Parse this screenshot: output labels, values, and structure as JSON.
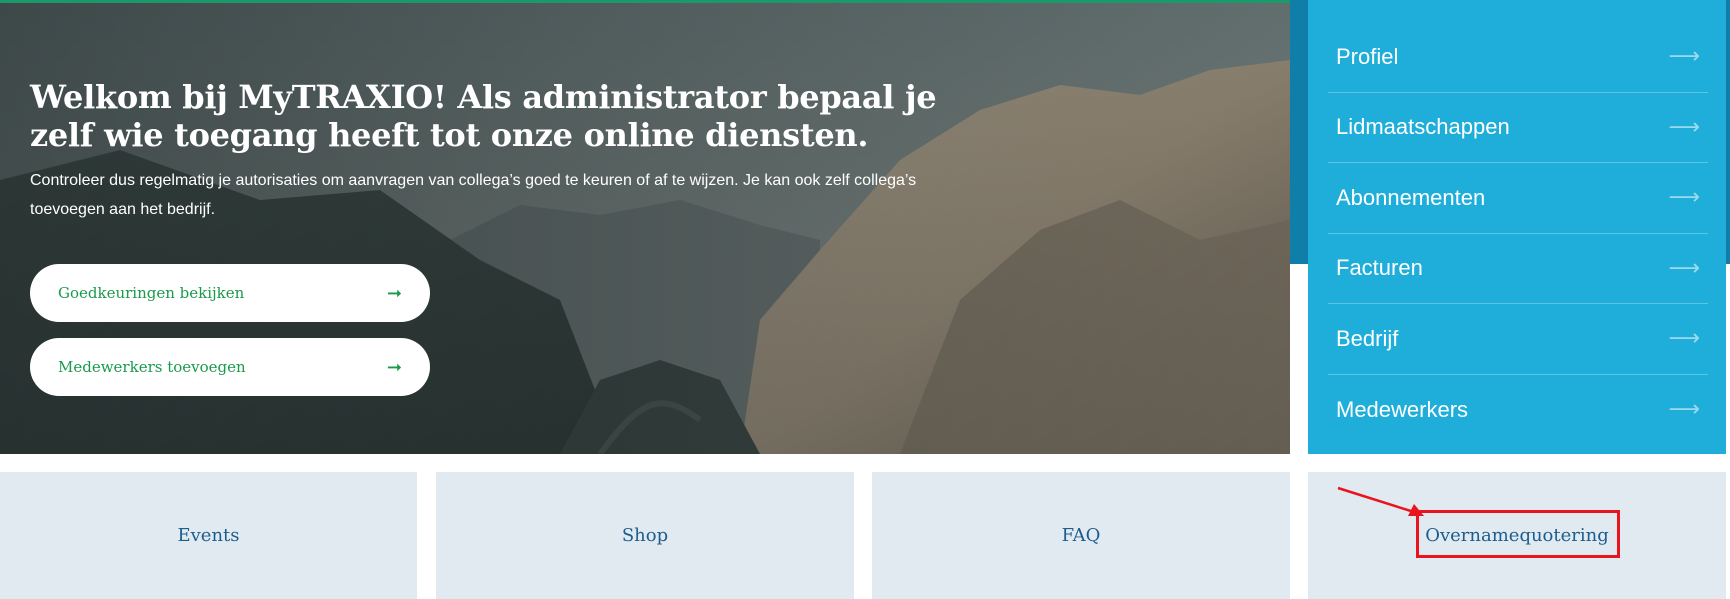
{
  "hero": {
    "title": "Welkom bij MyTRAXIO! Als administrator bepaal je zelf wie toegang heeft tot onze online diensten.",
    "text": "Controleer dus regelmatig je autorisaties om aanvragen van collega’s goed te keuren of af te wijzen. Je kan ook zelf collega’s toevoegen aan het bedrijf.",
    "buttons": [
      {
        "label": "Goedkeuringen bekijken",
        "icon": "arrow-right-icon"
      },
      {
        "label": "Medewerkers toevoegen",
        "icon": "arrow-right-icon"
      }
    ]
  },
  "side_menu": {
    "items": [
      {
        "label": "Profiel"
      },
      {
        "label": "Lidmaatschappen"
      },
      {
        "label": "Abonnementen"
      },
      {
        "label": "Facturen"
      },
      {
        "label": "Bedrijf"
      },
      {
        "label": "Medewerkers"
      }
    ],
    "arrow_glyph": "⟶"
  },
  "tiles": [
    {
      "label": "Events"
    },
    {
      "label": "Shop"
    },
    {
      "label": "FAQ"
    },
    {
      "label": "Overnamequotering"
    }
  ],
  "glyphs": {
    "button_arrow": "➞"
  },
  "colors": {
    "accent_green": "#1a9a4b",
    "menu_blue": "#1faed9",
    "menu_dark_blue": "#0f7ea8",
    "tile_bg": "#e1eaf1",
    "tile_text": "#1c5d8e",
    "annotation_red": "#e8141e"
  }
}
